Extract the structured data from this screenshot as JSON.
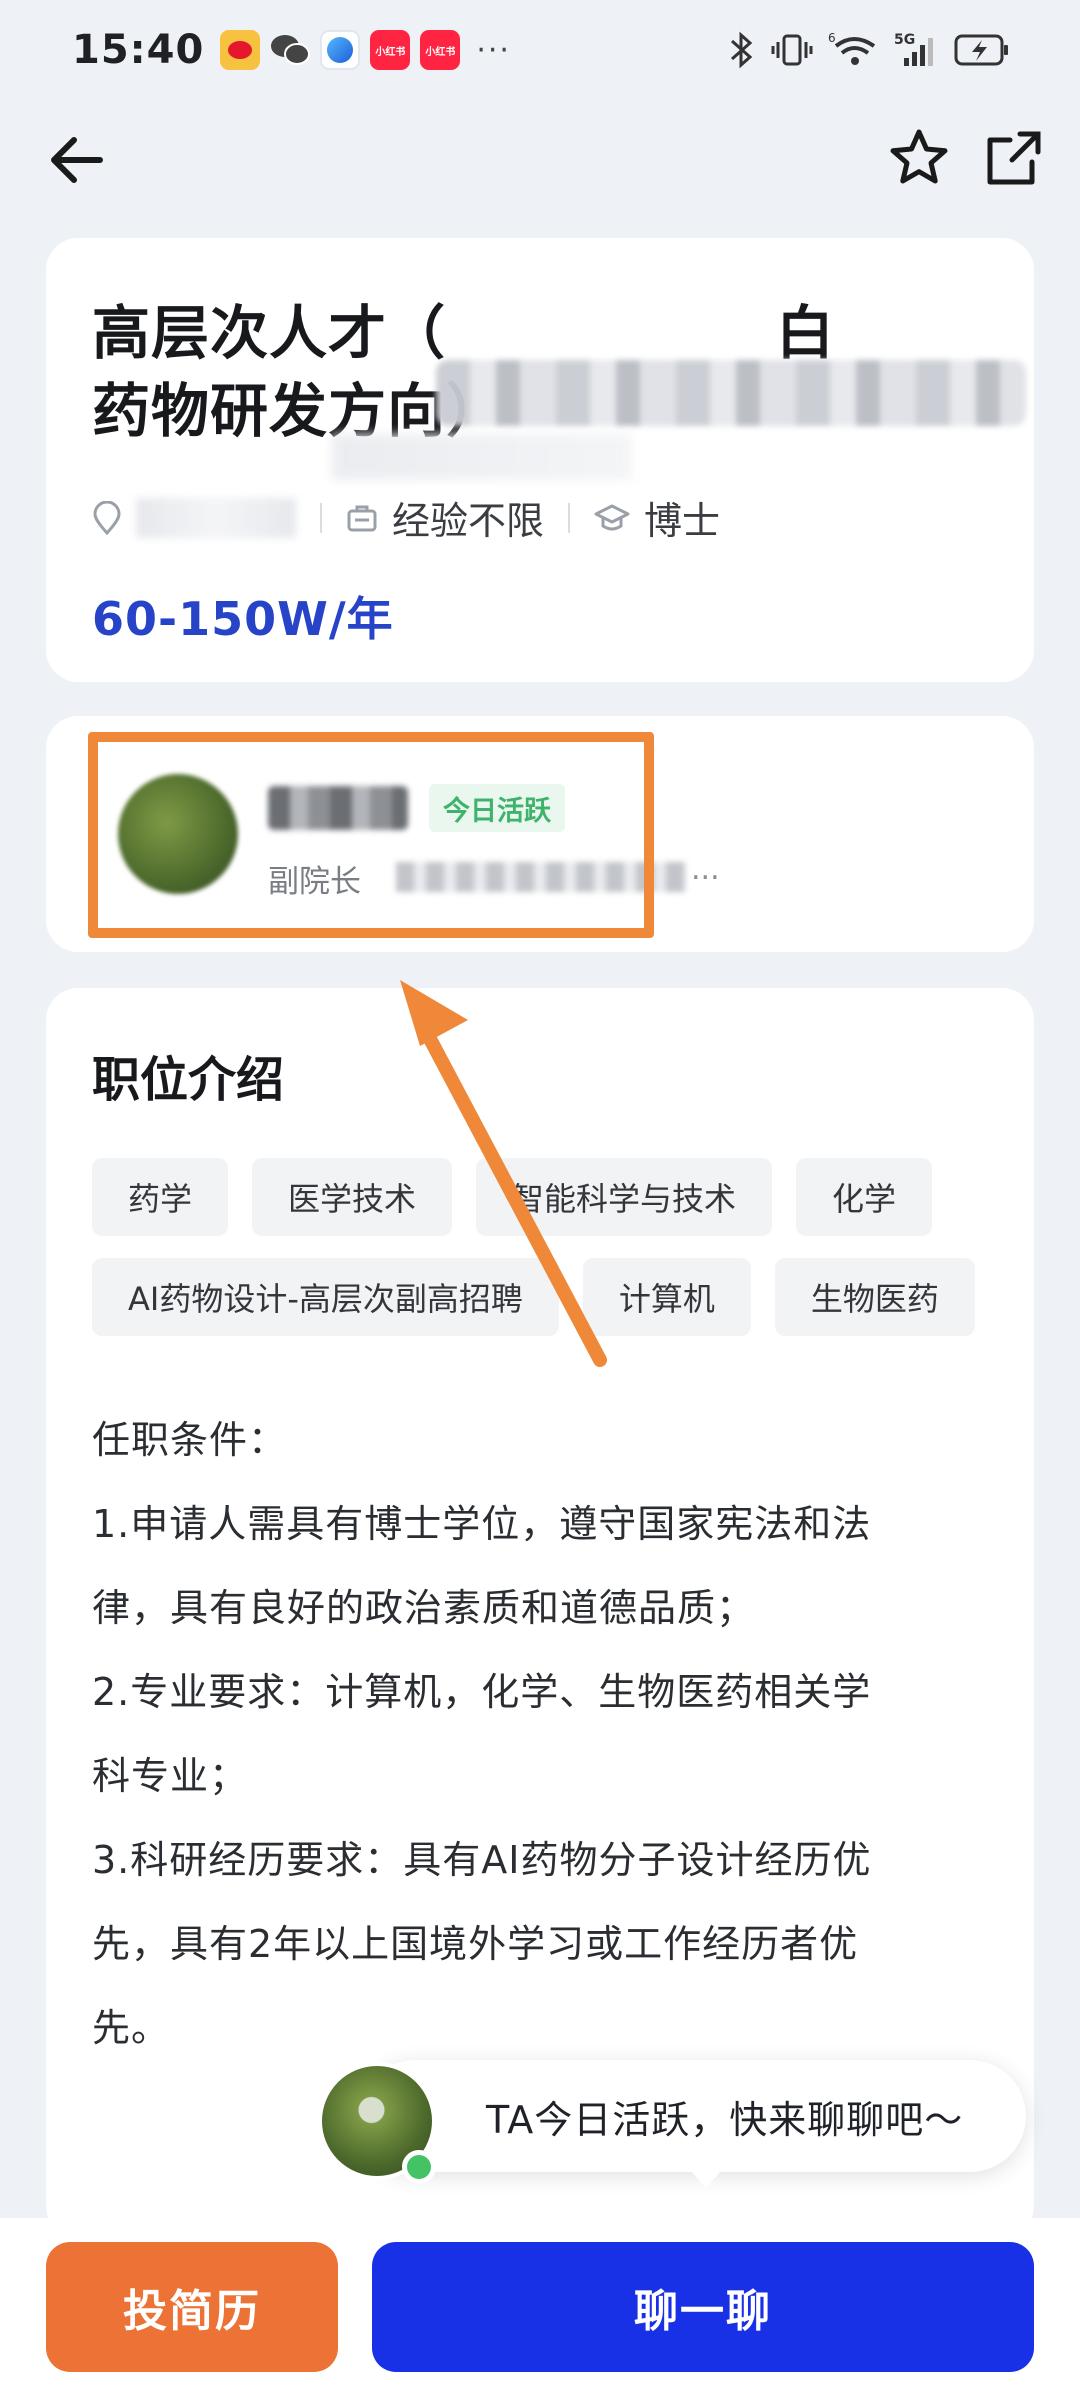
{
  "status_bar": {
    "time": "15:40",
    "app_icons": [
      "weibo-icon",
      "wechat-icon",
      "browser-icon",
      "xiaohongshu-icon",
      "xiaohongshu-icon"
    ],
    "xhs_label": "小红书",
    "more": "···",
    "network": "5G",
    "sim_slot": "6"
  },
  "job": {
    "title_line1": "高层次人才（",
    "title_line1_end": "白",
    "title_line2": "药物研发方向）",
    "experience": "经验不限",
    "degree": "博士",
    "salary": "60-150W/年"
  },
  "recruiter": {
    "active_badge": "今日活跃",
    "role": "副院长",
    "ellipsis": "..."
  },
  "description": {
    "section_title": "职位介绍",
    "tags": [
      "药学",
      "医学技术",
      "智能科学与技术",
      "化学",
      "AI药物设计-高层次副高招聘",
      "计算机",
      "生物医药"
    ],
    "lines": [
      "任职条件：",
      "1.申请人需具有博士学位，遵守国家宪法和法",
      "律，具有良好的政治素质和道德品质；",
      "2.专业要求：计算机，化学、生物医药相关学",
      "科专业；",
      "3.科研经历要求：具有AI药物分子设计经历优",
      "先，具有2年以上国境外学习或工作经历者优",
      "先。"
    ]
  },
  "chat_prompt": {
    "text": "TA今日活跃，快来聊聊吧～"
  },
  "actions": {
    "resume_label": "投简历",
    "chat_label": "聊一聊"
  },
  "colors": {
    "salary": "#2744c8",
    "active_green": "#3fb36b",
    "resume_button": "#ec7335",
    "chat_button": "#1931e6",
    "annotation": "#f0883a"
  }
}
